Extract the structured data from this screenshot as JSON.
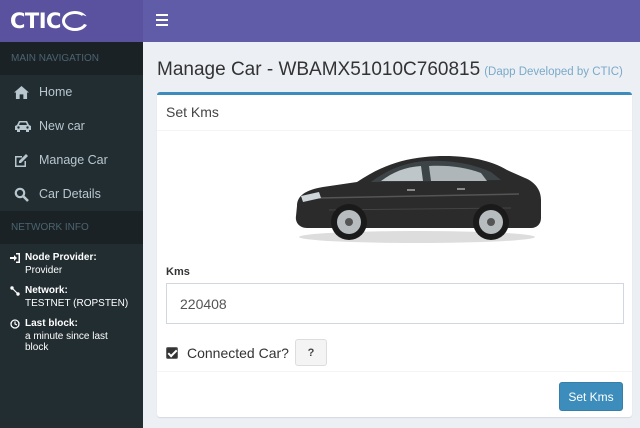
{
  "brand": {
    "logo_text": "CTIC"
  },
  "sidebar": {
    "main_header": "MAIN NAVIGATION",
    "items": [
      {
        "label": "Home",
        "icon": "home-icon"
      },
      {
        "label": "New car",
        "icon": "car-icon"
      },
      {
        "label": "Manage Car",
        "icon": "edit-icon"
      },
      {
        "label": "Car Details",
        "icon": "search-icon"
      }
    ],
    "network_header": "NETWORK INFO",
    "network": [
      {
        "label": "Node Provider:",
        "value": "Provider",
        "icon": "sign-in-icon"
      },
      {
        "label": "Network:",
        "value": "TESTNET (ROPSTEN)",
        "icon": "network-icon"
      },
      {
        "label": "Last block:",
        "value": "a minute since last block",
        "icon": "clock-icon"
      }
    ]
  },
  "page": {
    "title": "Manage Car - WBAMX51010C760815",
    "subtitle": "(Dapp Developed by CTIC)"
  },
  "box": {
    "title": "Set Kms",
    "kms_label": "Kms",
    "kms_value": "220408",
    "connected_label": "Connected Car?",
    "connected_checked": true,
    "help_label": "?",
    "submit_label": "Set Kms"
  },
  "colors": {
    "header": "#605ca8",
    "logo_bg": "#5a519f",
    "sidebar": "#222d32",
    "primary": "#3c8dbc"
  }
}
